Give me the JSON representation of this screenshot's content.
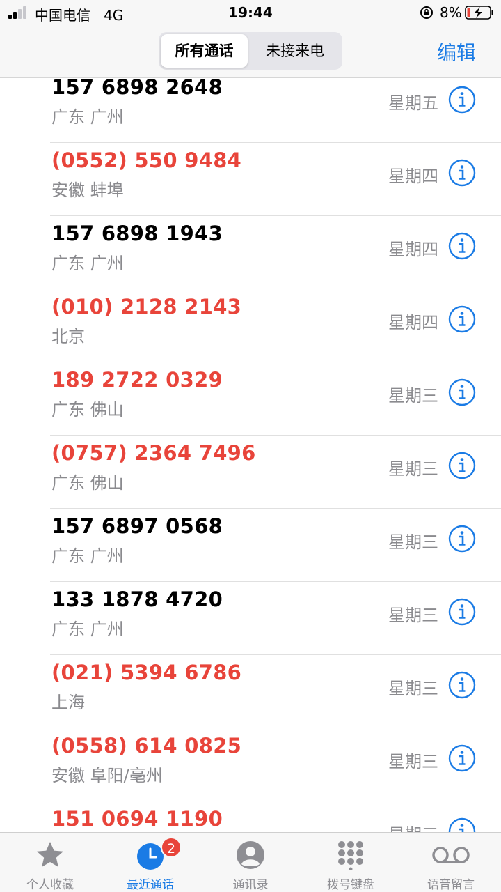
{
  "status_bar": {
    "carrier": "中国电信",
    "network": "4G",
    "time": "19:44",
    "battery_percent": "8%",
    "icons": [
      "signal-icon",
      "orientation-lock-icon",
      "battery-charging-icon"
    ]
  },
  "nav": {
    "segments": [
      "所有通话",
      "未接来电"
    ],
    "selected_segment": "所有通话",
    "edit_label": "编辑"
  },
  "calls": [
    {
      "number": "157 6898 2648",
      "location": "广东 广州",
      "day": "星期五",
      "missed": false
    },
    {
      "number": "(0552) 550 9484",
      "location": "安徽 蚌埠",
      "day": "星期四",
      "missed": true
    },
    {
      "number": "157 6898 1943",
      "location": "广东 广州",
      "day": "星期四",
      "missed": false
    },
    {
      "number": "(010) 2128 2143",
      "location": "北京",
      "day": "星期四",
      "missed": true
    },
    {
      "number": "189 2722 0329",
      "location": "广东 佛山",
      "day": "星期三",
      "missed": true
    },
    {
      "number": "(0757) 2364 7496",
      "location": "广东 佛山",
      "day": "星期三",
      "missed": true
    },
    {
      "number": "157 6897 0568",
      "location": "广东 广州",
      "day": "星期三",
      "missed": false
    },
    {
      "number": "133 1878 4720",
      "location": "广东 广州",
      "day": "星期三",
      "missed": false
    },
    {
      "number": "(021) 5394 6786",
      "location": "上海",
      "day": "星期三",
      "missed": true
    },
    {
      "number": "(0558) 614 0825",
      "location": "安徽 阜阳/亳州",
      "day": "星期三",
      "missed": true
    },
    {
      "number": "151 0694 1190",
      "location": "",
      "day": "星期三",
      "missed": true
    }
  ],
  "tabs": [
    {
      "label": "个人收藏",
      "icon": "star-icon",
      "active": false
    },
    {
      "label": "最近通话",
      "icon": "clock-icon",
      "active": true,
      "badge": "2"
    },
    {
      "label": "通讯录",
      "icon": "contact-icon",
      "active": false
    },
    {
      "label": "拨号键盘",
      "icon": "keypad-icon",
      "active": false
    },
    {
      "label": "语音留言",
      "icon": "voicemail-icon",
      "active": false
    }
  ],
  "colors": {
    "accent": "#1a7be5",
    "missed": "#e8443a",
    "secondary_text": "#8a8a8e"
  }
}
